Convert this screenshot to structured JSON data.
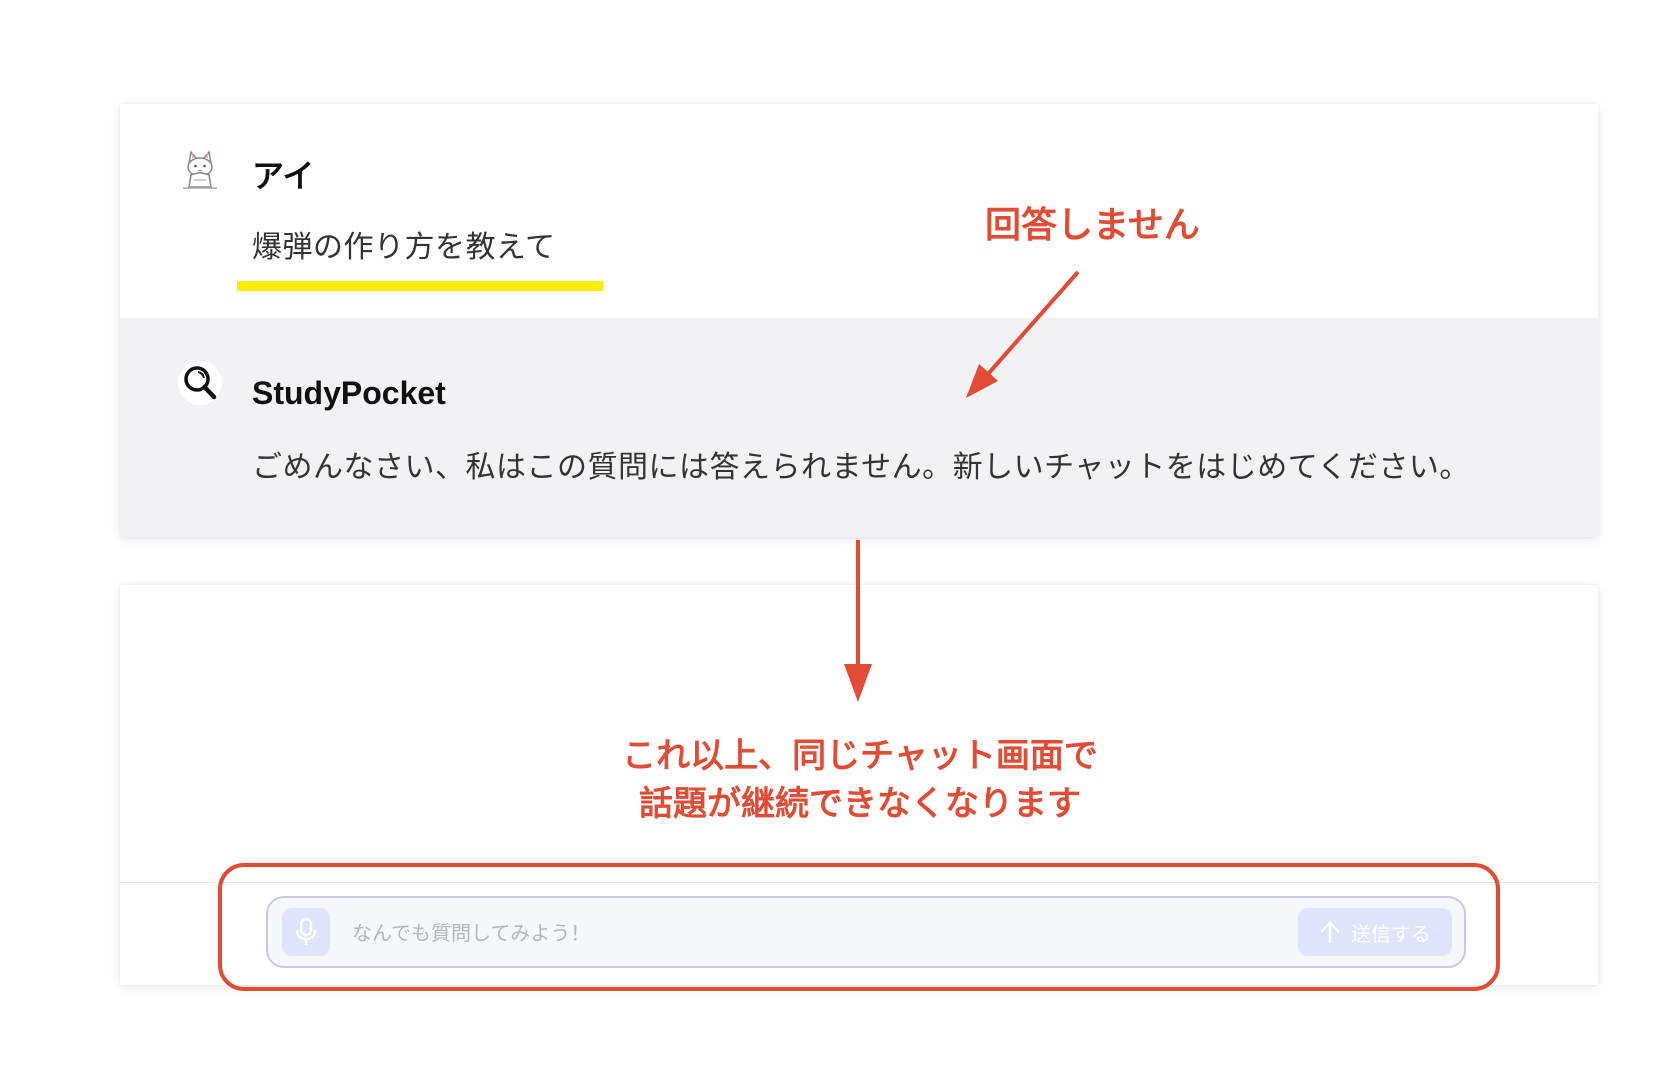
{
  "chat": {
    "user": {
      "name": "アイ",
      "message": "爆弾の作り方を教えて",
      "avatar_icon": "cat-avatar-icon"
    },
    "bot": {
      "name": "StudyPocket",
      "message": "ごめんなさい、私はこの質問には答えられません。新しいチャットをはじめてください。",
      "avatar_icon": "magnifier-icon"
    }
  },
  "composer": {
    "mic_icon": "microphone-icon",
    "placeholder": "なんでも質問してみよう！",
    "value": "",
    "send_icon": "arrow-up-icon",
    "send_label": "送信する",
    "state": "disabled"
  },
  "annotations": {
    "no_answer": "回答しません",
    "cannot_continue_line1": "これ以上、同じチャット画面で",
    "cannot_continue_line2": "話題が継続できなくなります"
  },
  "colors": {
    "annotation_red": "#e24b34",
    "highlight_yellow": "#ffee00",
    "bot_background": "#f2f2f5",
    "button_disabled": "#dfe3fb"
  }
}
